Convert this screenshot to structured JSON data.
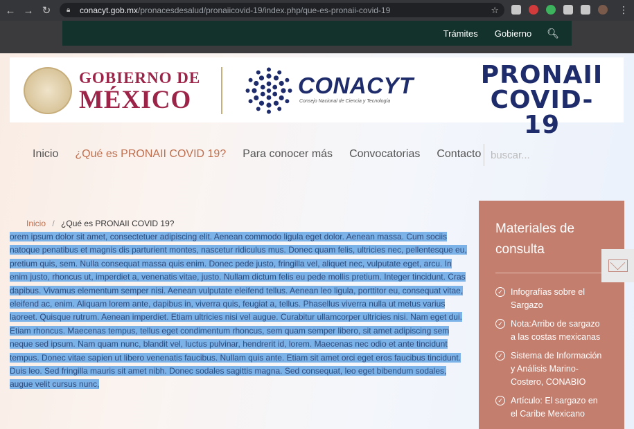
{
  "browser": {
    "url_host": "conacyt.gob.mx",
    "url_path": "/pronacesdesalud/pronaiicovid-19/index.php/que-es-pronaii-covid-19"
  },
  "topbar": {
    "links": [
      "Trámites",
      "Gobierno"
    ]
  },
  "header": {
    "gob_line1": "GOBIERNO DE",
    "gob_line2": "MÉXICO",
    "conacyt_name": "CONACYT",
    "conacyt_sub": "Consejo Nacional de Ciencia y Tecnología",
    "pronaii_line1": "PRONAII",
    "pronaii_line2": "COVID-19"
  },
  "nav": {
    "items": [
      "Inicio",
      "¿Qué es PRONAII COVID 19?",
      "Para conocer más",
      "Convocatorias",
      "Contacto"
    ],
    "search_placeholder": "buscar..."
  },
  "breadcrumb": {
    "home": "Inicio",
    "separator": "/",
    "current": "¿Qué es PRONAII COVID 19?"
  },
  "content": {
    "text": "orem ipsum dolor sit amet, consectetuer adipiscing elit. Aenean commodo ligula eget dolor. Aenean massa. Cum sociis natoque penatibus et magnis dis parturient montes, nascetur ridiculus mus. Donec quam felis, ultricies nec, pellentesque eu, pretium quis, sem. Nulla consequat massa quis enim. Donec pede justo, fringilla vel, aliquet nec, vulputate eget, arcu. In enim justo, rhoncus ut, imperdiet a, venenatis vitae, justo. Nullam dictum felis eu pede mollis pretium. Integer tincidunt. Cras dapibus. Vivamus elementum semper nisi. Aenean vulputate eleifend tellus. Aenean leo ligula, porttitor eu, consequat vitae, eleifend ac, enim. Aliquam lorem ante, dapibus in, viverra quis, feugiat a, tellus. Phasellus viverra nulla ut metus varius laoreet. Quisque rutrum. Aenean imperdiet. Etiam ultricies nisi vel augue. Curabitur ullamcorper ultricies nisi. Nam eget dui. Etiam rhoncus. Maecenas tempus, tellus eget condimentum rhoncus, sem quam semper libero, sit amet adipiscing sem neque sed ipsum. Nam quam nunc, blandit vel, luctus pulvinar, hendrerit id, lorem. Maecenas nec odio et ante tincidunt tempus. Donec vitae sapien ut libero venenatis faucibus. Nullam quis ante. Etiam sit amet orci eget eros faucibus tincidunt. Duis leo. Sed fringilla mauris sit amet nibh. Donec sodales sagittis magna. Sed consequat, leo eget bibendum sodales, augue velit cursus nunc,"
  },
  "sidebar": {
    "title": "Materiales de consulta",
    "items": [
      "Infografías sobre el Sargazo",
      "Nota:Arribo de sargazo a las costas mexicanas",
      "Sistema de Información y Análisis Marino-Costero, CONABIO",
      "Artículo: El sargazo en el Caribe Mexicano"
    ]
  },
  "colors": {
    "accent": "#bf6f4e",
    "sidebar_bg": "#c47e6e",
    "selection": "#7bb2e8",
    "gob_red": "#9d2449",
    "conacyt_blue": "#1f2c6b",
    "topbar_green": "#13322b"
  }
}
